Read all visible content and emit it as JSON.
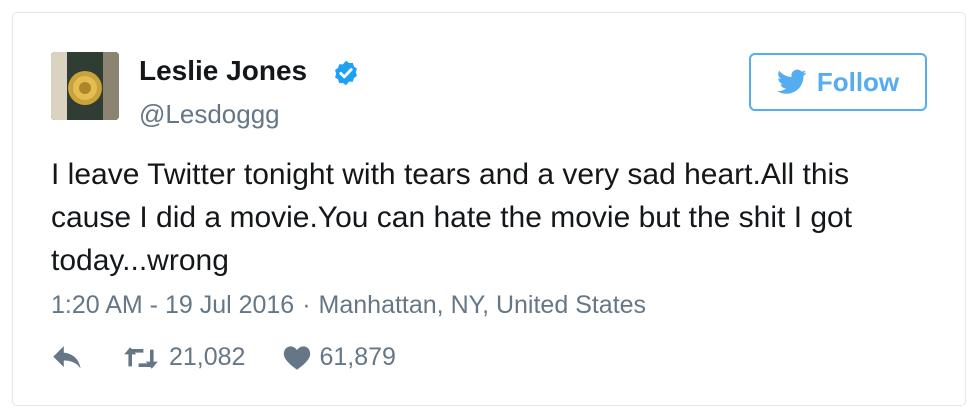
{
  "tweet": {
    "author": {
      "name": "Leslie Jones",
      "handle": "@Lesdoggg",
      "verified": true
    },
    "follow_label": "Follow",
    "text": "I leave Twitter tonight with tears and a very sad heart.All this cause I did a movie.You can hate the movie but the shit I got today...wrong",
    "time": "1:20 AM - 19 Jul 2016",
    "location": "Manhattan, NY, United States",
    "retweets": "21,082",
    "likes": "61,879",
    "colors": {
      "accent": "#55acee",
      "text": "#14171a",
      "muted": "#657786"
    }
  }
}
